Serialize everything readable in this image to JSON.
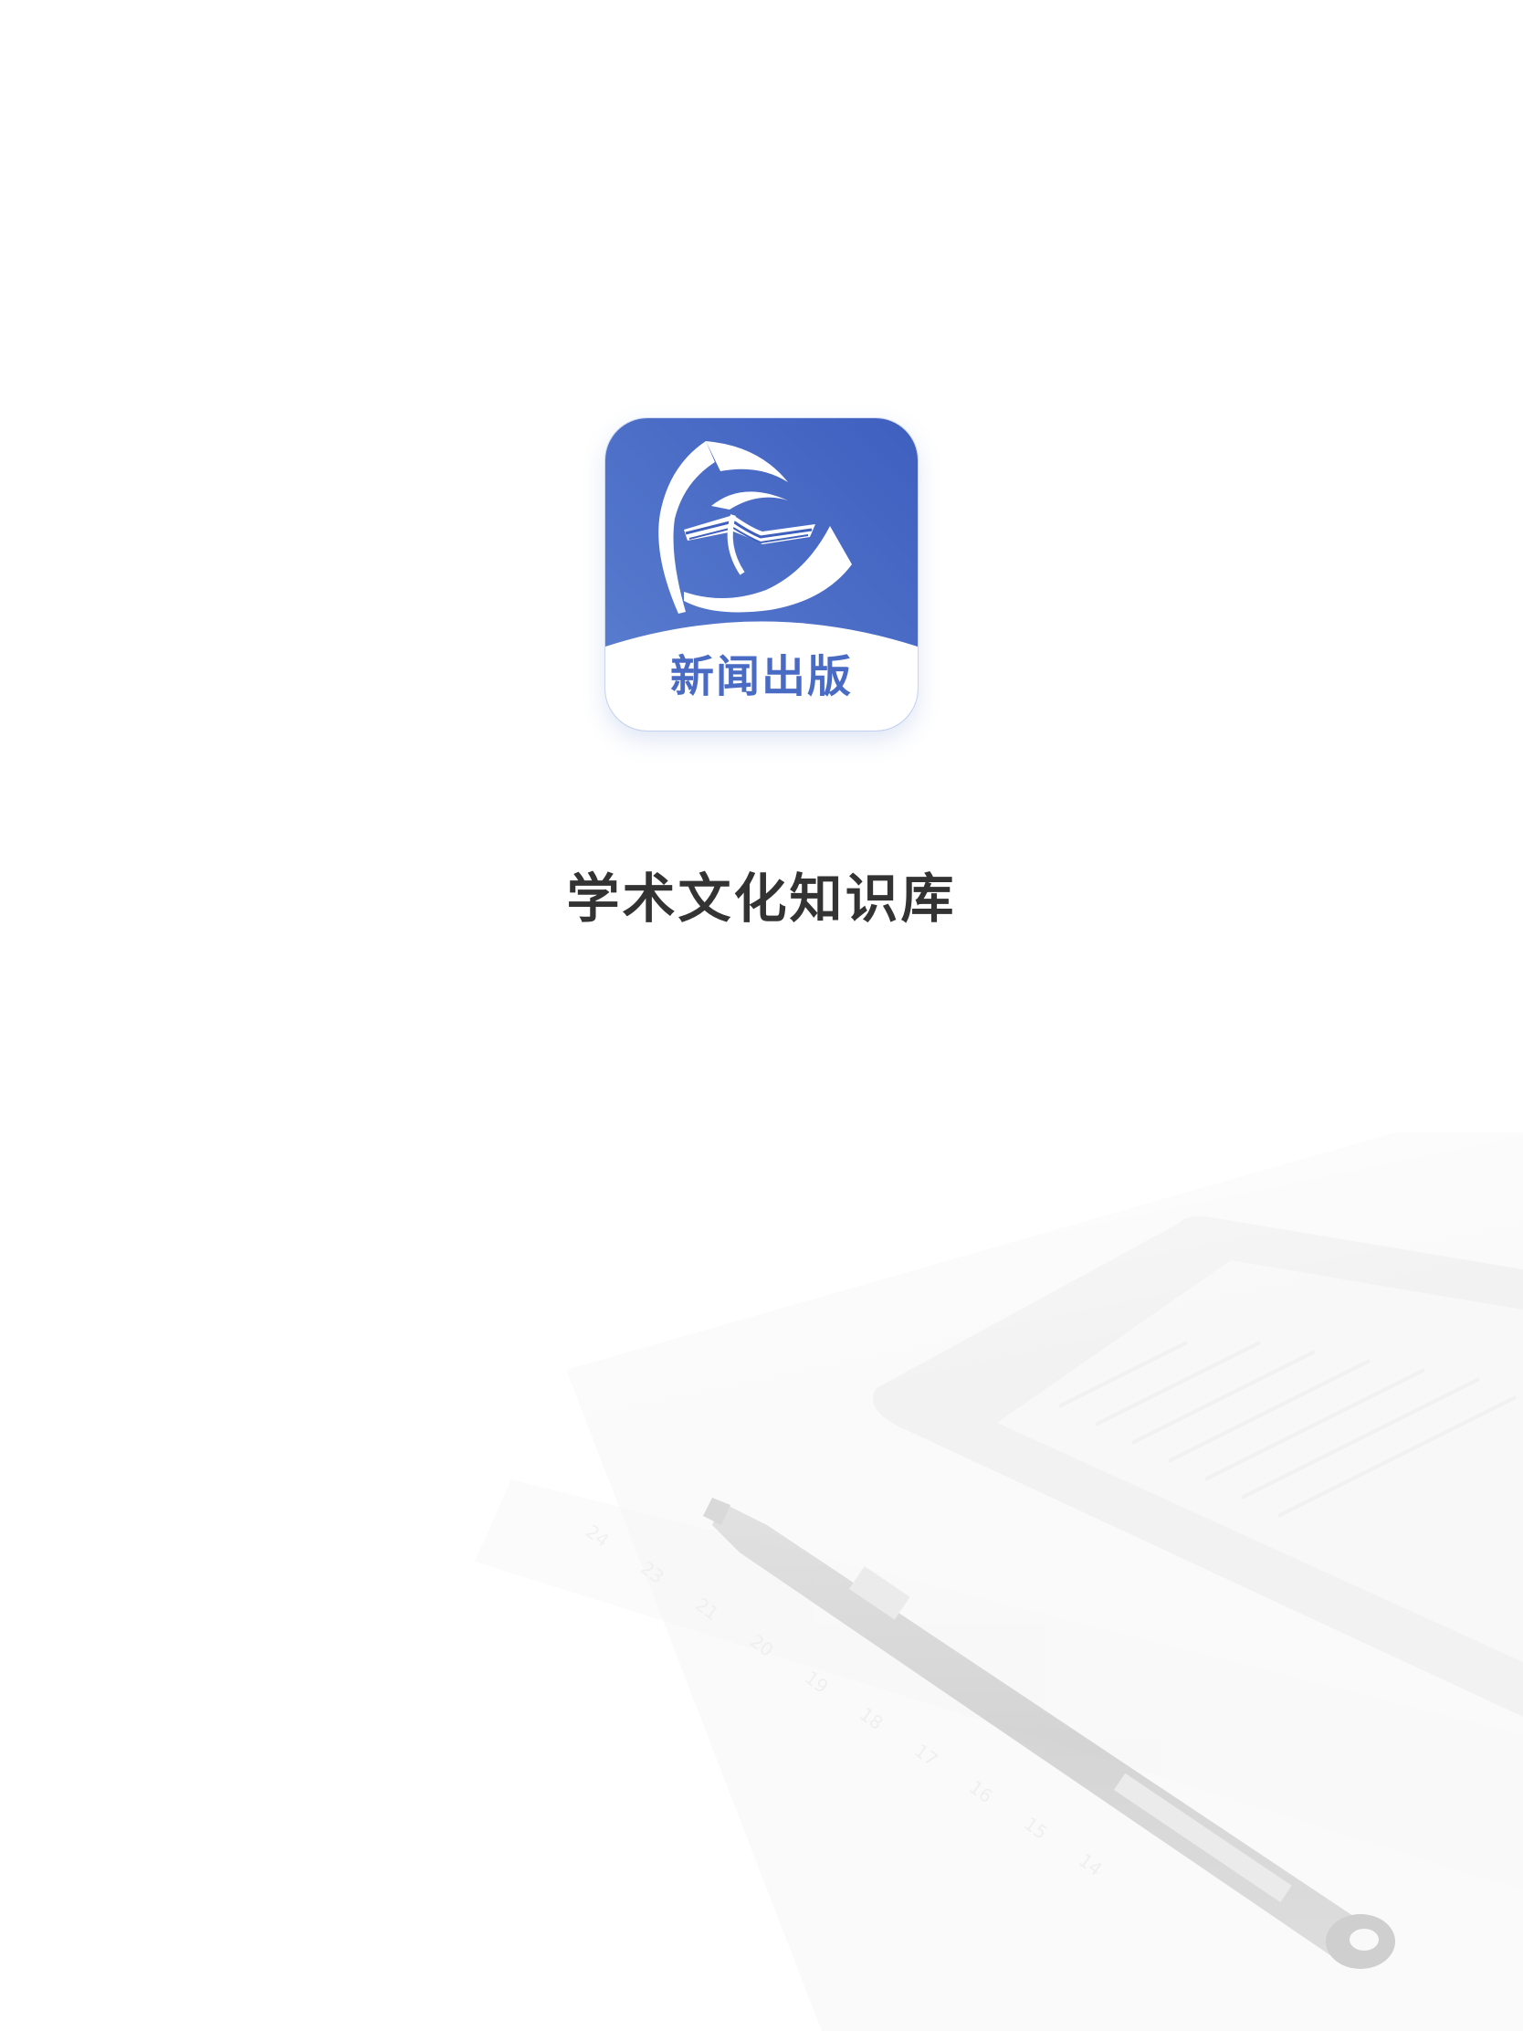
{
  "app": {
    "icon_name": "book-swoosh-logo-icon",
    "icon_label": "新闻出版",
    "tagline": "学术文化知识库"
  },
  "background": {
    "scene": "ereader-and-pen-photo"
  },
  "colors": {
    "icon_blue": "#4a6bc4",
    "icon_blue_dark": "#3f5fbf",
    "icon_blue_light": "#5b7fd0",
    "tagline_text": "#333333",
    "page_background": "#ffffff"
  }
}
